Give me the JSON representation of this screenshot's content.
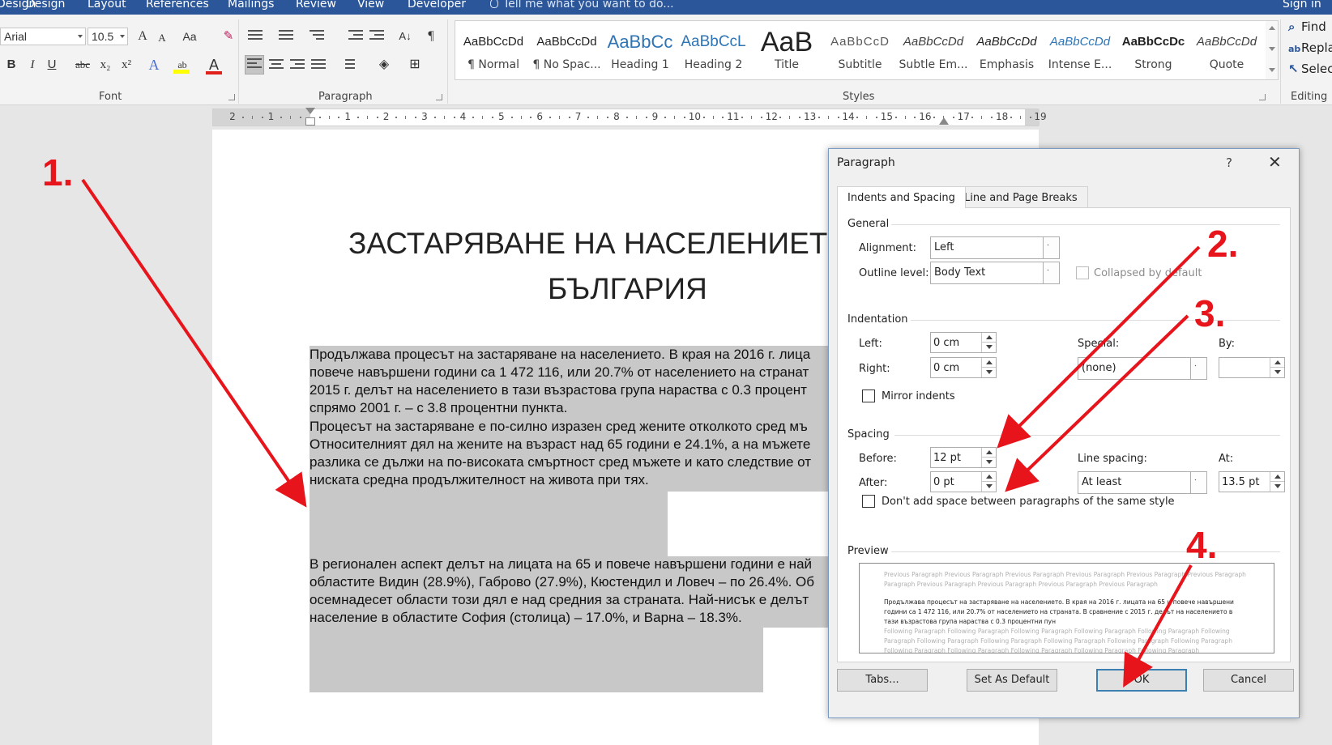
{
  "menu": {
    "items": [
      "Design",
      "Layout",
      "References",
      "Mailings",
      "Review",
      "View",
      "Developer"
    ],
    "tell_me": "Tell me what you want to do...",
    "sign_in": "Sign in"
  },
  "ribbon": {
    "font": {
      "name": "Arial",
      "size": "10.5",
      "group_label": "Font",
      "bold": "B",
      "italic": "I",
      "underline": "U",
      "strike": "abc",
      "subscript": "x₂",
      "superscript": "x²",
      "case": "Aa",
      "grow": "A",
      "shrink": "A"
    },
    "paragraph": {
      "group_label": "Paragraph"
    },
    "styles": {
      "group_label": "Styles",
      "items": [
        {
          "preview": "AaBbCcDd",
          "name": "¶ Normal"
        },
        {
          "preview": "AaBbCcDd",
          "name": "¶ No Spac..."
        },
        {
          "preview": "AaBbCc",
          "name": "Heading 1"
        },
        {
          "preview": "AaBbCcL",
          "name": "Heading 2"
        },
        {
          "preview": "AaB",
          "name": "Title"
        },
        {
          "preview": "AaBbCcD",
          "name": "Subtitle"
        },
        {
          "preview": "AaBbCcDd",
          "name": "Subtle Em..."
        },
        {
          "preview": "AaBbCcDd",
          "name": "Emphasis"
        },
        {
          "preview": "AaBbCcDd",
          "name": "Intense E..."
        },
        {
          "preview": "AaBbCcDc",
          "name": "Strong"
        },
        {
          "preview": "AaBbCcDd",
          "name": "Quote"
        }
      ]
    },
    "editing": {
      "group_label": "Editing",
      "find": "Find",
      "replace": "Repla",
      "select": "Selec"
    }
  },
  "ruler": {
    "labels": [
      "2",
      "1",
      "",
      "1",
      "2",
      "3",
      "4",
      "5",
      "6",
      "7",
      "8",
      "9",
      "10",
      "11",
      "12",
      "13",
      "14",
      "15",
      "16",
      "17",
      "18",
      "19"
    ]
  },
  "document": {
    "title_line1": "ЗАСТАРЯВАНЕ НА НАСЕЛЕНИЕТ",
    "title_line2": "БЪЛГАРИЯ",
    "paragraph1": [
      "Продължава процесът на застаряване на населението. В края на 2016 г. лица",
      "повече навършени години са 1 472 116, или 20.7% от населението на странат",
      "2015 г. делът на населението в тази възрастова група нараства с 0.3 процент",
      "спрямо 2001 г. – с 3.8 процентни пункта."
    ],
    "paragraph2": [
      "Процесът на застаряване е по-силно изразен сред жените отколкото сред мъ",
      "Относителният дял на жените на възраст над 65 години е 24.1%, а на мъжете",
      "разлика се дължи на по-високата смъртност сред мъжете и като следствие от",
      "ниската средна продължителност на живота при тях."
    ],
    "paragraph3": [
      "В регионален аспект делът на лицата на 65 и повече навършени години е най",
      "областите Видин (28.9%), Габрово (27.9%), Кюстендил и Ловеч – по 26.4%. Об",
      "осемнадесет области този дял е над средния за страната. Най-нисък е делът",
      "население в областите София (столица) – 17.0%, и Варна – 18.3%."
    ]
  },
  "annotations": {
    "n1": "1.",
    "n2": "2.",
    "n3": "3.",
    "n4": "4.",
    "color": "#e8141c"
  },
  "dialog": {
    "title": "Paragraph",
    "help": "?",
    "close": "✕",
    "tabs": [
      "Indents and Spacing",
      "Line and Page Breaks"
    ],
    "general": {
      "label": "General",
      "alignment_label": "Alignment:",
      "alignment_value": "Left",
      "outline_label": "Outline level:",
      "outline_value": "Body Text",
      "collapsed_label": "Collapsed by default"
    },
    "indentation": {
      "label": "Indentation",
      "left_label": "Left:",
      "left_value": "0 cm",
      "right_label": "Right:",
      "right_value": "0 cm",
      "special_label": "Special:",
      "special_value": "(none)",
      "by_label": "By:",
      "by_value": "",
      "mirror_label": "Mirror indents"
    },
    "spacing": {
      "label": "Spacing",
      "before_label": "Before:",
      "before_value": "12 pt",
      "after_label": "After:",
      "after_value": "0 pt",
      "line_spacing_label": "Line spacing:",
      "line_spacing_value": "At least",
      "at_label": "At:",
      "at_value": "13.5 pt",
      "dont_add_label": "Don't add space between paragraphs of the same style"
    },
    "preview": {
      "label": "Preview",
      "previous": [
        "Previous Paragraph Previous Paragraph Previous Paragraph Previous Paragraph Previous Paragraph Previous Paragraph",
        "Paragraph Previous Paragraph Previous Paragraph Previous Paragraph Previous Paragraph"
      ],
      "current": [
        "Продължава процесът на застаряване на населението. В края на 2016 г. лицата на 65 и повече навършени",
        "години са 1 472 116, или 20.7% от населението на страната. В сравнение с 2015 г. делът на населението в",
        "тази възрастова група нараства с 0.3 процентни пун"
      ],
      "following": [
        "Following Paragraph Following Paragraph Following Paragraph Following Paragraph Following Paragraph Following",
        "Paragraph Following Paragraph Following Paragraph Following Paragraph Following Paragraph Following Paragraph",
        "Following Paragraph Following Paragraph Following Paragraph Following Paragraph Following Paragraph"
      ]
    },
    "buttons": {
      "tabs": "Tabs...",
      "set_default": "Set As Default",
      "ok": "OK",
      "cancel": "Cancel"
    }
  }
}
